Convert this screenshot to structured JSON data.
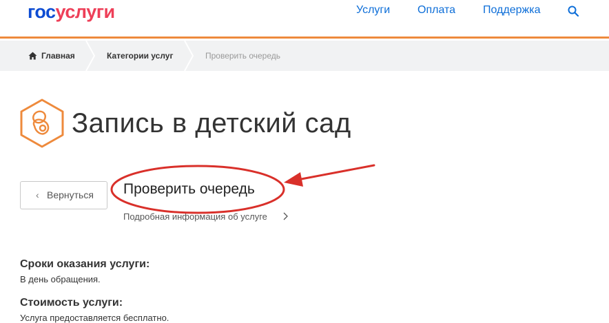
{
  "header": {
    "logo_part1": "гос",
    "logo_part2": "услуги",
    "nav": [
      "Услуги",
      "Оплата",
      "Поддержка"
    ],
    "search_icon": "search-icon"
  },
  "breadcrumbs": [
    "Главная",
    "Категории услуг",
    "Проверить очередь"
  ],
  "page": {
    "title": "Запись в детский сад",
    "back_label": "Вернуться",
    "service_heading": "Проверить очередь",
    "more_link": "Подробная информация об услуге"
  },
  "details": [
    {
      "label": "Сроки оказания услуги:",
      "value": "В день обращения."
    },
    {
      "label": "Стоимость услуги:",
      "value": "Услуга предоставляется бесплатно."
    }
  ],
  "colors": {
    "accent_orange": "#ee8a3c",
    "logo_blue": "#0d4cd3",
    "logo_red": "#ee3f58",
    "link_blue": "#0d6ed8",
    "annotation_red": "#d9302a"
  }
}
